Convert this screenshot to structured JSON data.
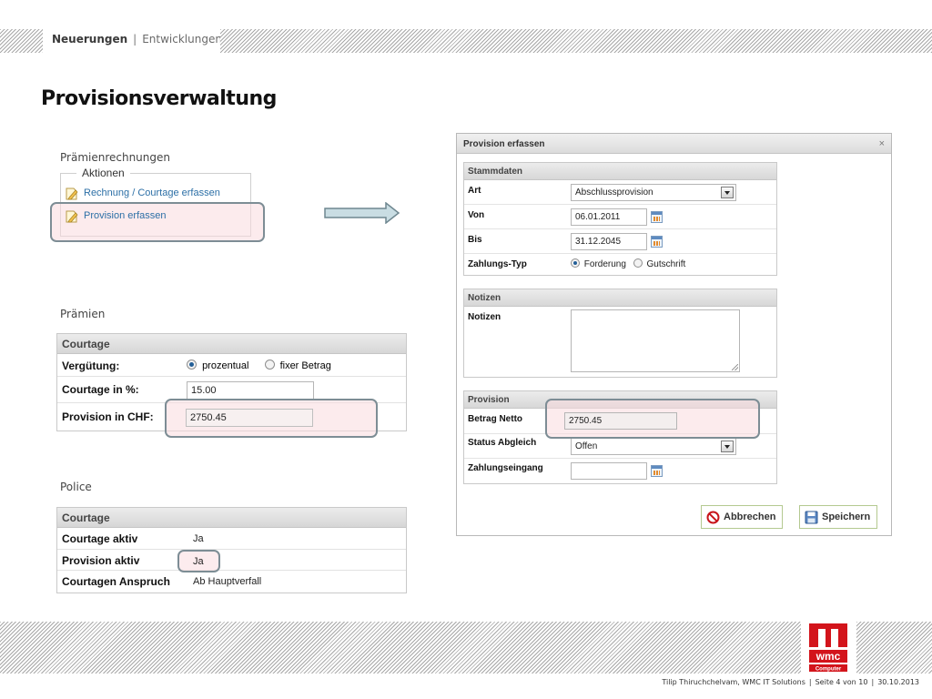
{
  "header": {
    "nav_primary": "Neuerungen",
    "nav_separator": "|",
    "nav_secondary": "Entwicklungen"
  },
  "page_title": "Provisionsverwaltung",
  "left": {
    "praemienrechnungen": {
      "section_label": "Prämienrechnungen",
      "legend": "Aktionen",
      "links": [
        "Rechnung / Courtage erfassen",
        "Provision erfassen"
      ]
    },
    "praemien": {
      "section_label": "Prämien",
      "panel_title": "Courtage",
      "verguetung_label": "Vergütung:",
      "radio_prozentual": "prozentual",
      "radio_fixer_betrag": "fixer Betrag",
      "courtage_label": "Courtage in %:",
      "courtage_value": "15.00",
      "provision_label": "Provision in CHF:",
      "provision_value": "2750.45"
    },
    "police": {
      "section_label": "Police",
      "panel_title": "Courtage",
      "rows": [
        {
          "label": "Courtage aktiv",
          "value": "Ja"
        },
        {
          "label": "Provision aktiv",
          "value": "Ja"
        },
        {
          "label": "Courtagen Anspruch",
          "value": "Ab Hauptverfall"
        }
      ]
    }
  },
  "dialog": {
    "title": "Provision erfassen",
    "close": "×",
    "stammdaten": {
      "title": "Stammdaten",
      "art_label": "Art",
      "art_value": "Abschlussprovision",
      "von_label": "Von",
      "von_value": "06.01.2011",
      "bis_label": "Bis",
      "bis_value": "31.12.2045",
      "zahlungstyp_label": "Zahlungs-Typ",
      "radio_forderung": "Forderung",
      "radio_gutschrift": "Gutschrift"
    },
    "notizen": {
      "title": "Notizen",
      "label": "Notizen"
    },
    "provision": {
      "title": "Provision",
      "betrag_label": "Betrag Netto",
      "betrag_value": "2750.45",
      "status_label": "Status Abgleich",
      "status_value": "Offen",
      "zahlungseingang_label": "Zahlungseingang",
      "zahlungseingang_value": ""
    },
    "buttons": {
      "cancel": "Abbrechen",
      "save": "Speichern"
    }
  },
  "footer": {
    "author": "Tilip Thiruchchelvam, WMC IT Solutions",
    "page": "Seite 4 von 10",
    "date": "30.10.2013",
    "separator": "|",
    "logo_text": "wmc",
    "logo_subtext": "Computer"
  },
  "colors": {
    "link": "#2c6fa6",
    "highlight_border": "#7d8d95",
    "highlight_fill": "#f9dade",
    "logo_red": "#d3141b",
    "button_border": "#b4c990"
  }
}
